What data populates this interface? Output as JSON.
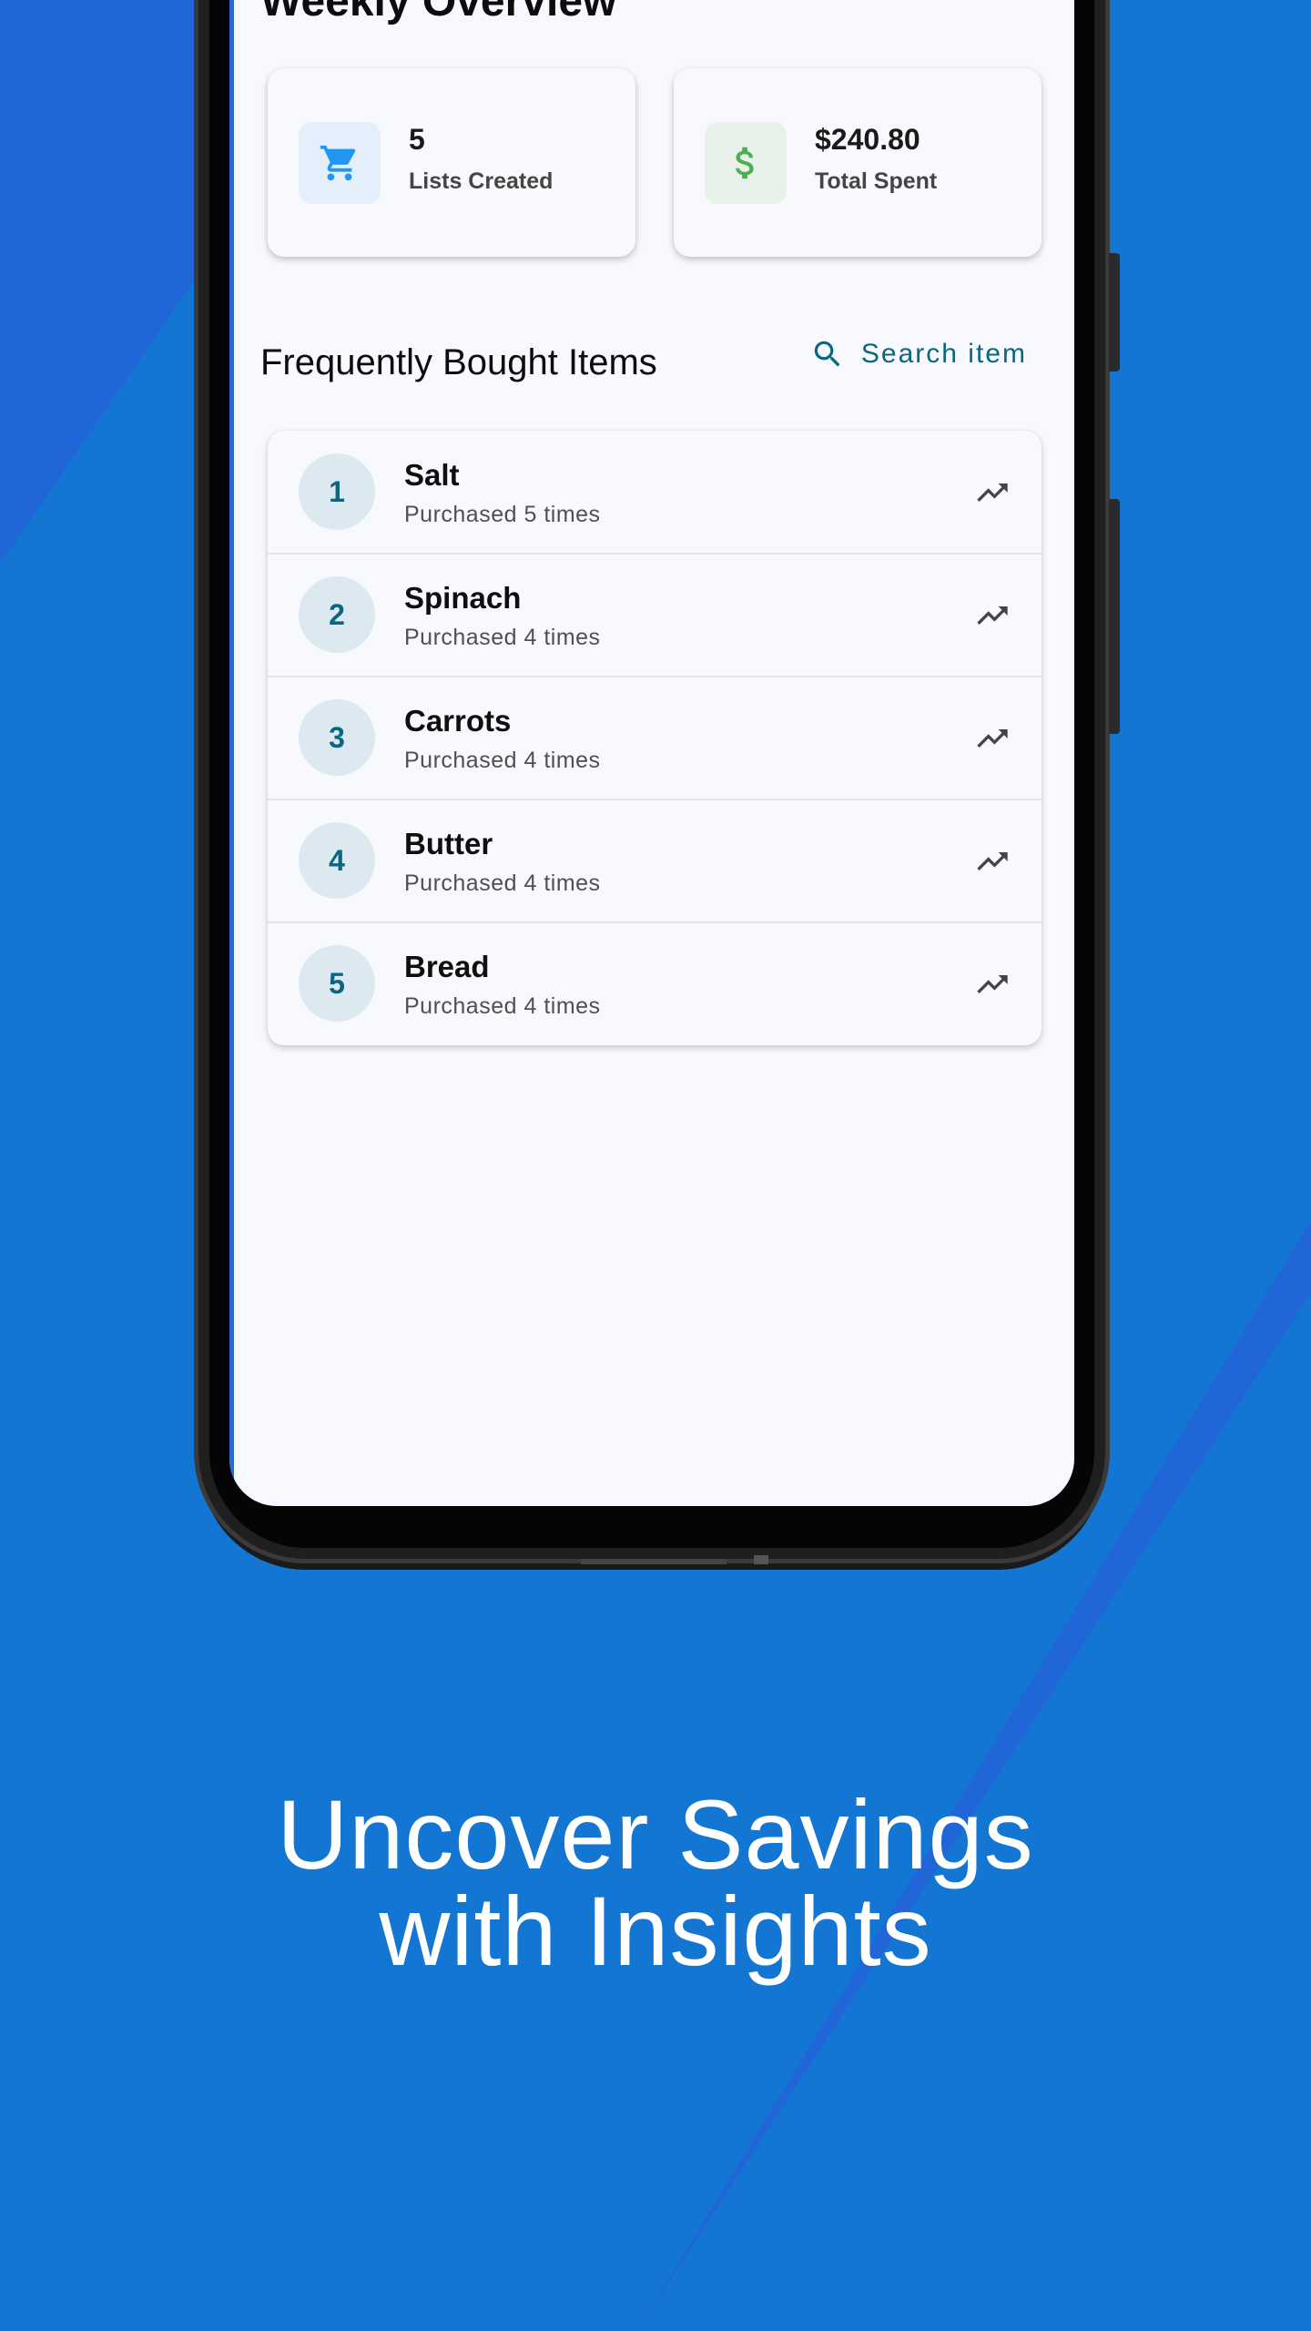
{
  "weekly_overview": {
    "title": "Weekly Overview",
    "cards": [
      {
        "value": "5",
        "label": "Lists Created",
        "icon": "cart-icon",
        "icon_color": "#2196f3",
        "icon_bg": "#e3f0fb"
      },
      {
        "value": "$240.80",
        "label": "Total Spent",
        "icon": "dollar-icon",
        "icon_color": "#4caf50",
        "icon_bg": "#e8f2ea"
      }
    ]
  },
  "frequent_items": {
    "title": "Frequently Bought Items",
    "search_label": "Search item",
    "items": [
      {
        "rank": "1",
        "name": "Salt",
        "subtitle": "Purchased 5 times"
      },
      {
        "rank": "2",
        "name": "Spinach",
        "subtitle": "Purchased 4 times"
      },
      {
        "rank": "3",
        "name": "Carrots",
        "subtitle": "Purchased 4 times"
      },
      {
        "rank": "4",
        "name": "Butter",
        "subtitle": "Purchased 4 times"
      },
      {
        "rank": "5",
        "name": "Bread",
        "subtitle": "Purchased 4 times"
      }
    ]
  },
  "promo": {
    "line1": "Uncover Savings",
    "line2": "with Insights"
  },
  "colors": {
    "background": "#2166d8",
    "background_stripe": "#1276d2",
    "accent": "#0b6781"
  }
}
